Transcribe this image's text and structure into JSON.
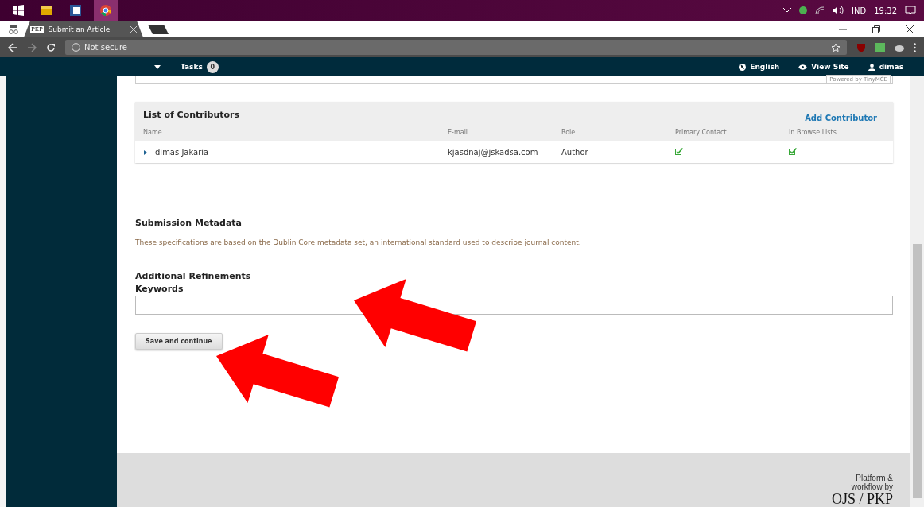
{
  "taskbar": {
    "tray_language": "IND",
    "time": "19:32"
  },
  "browser": {
    "tab_title": "Submit an Article",
    "favicon": "PKP",
    "security": "Not secure"
  },
  "header": {
    "tasks_label": "Tasks",
    "tasks_count": "0",
    "language": "English",
    "view_site": "View Site",
    "user": "dimas"
  },
  "editor": {
    "powered_by": "Powered by TinyMCE"
  },
  "contributors": {
    "title": "List of Contributors",
    "add_label": "Add Contributor",
    "columns": [
      "Name",
      "E-mail",
      "Role",
      "Primary Contact",
      "In Browse Lists"
    ],
    "rows": [
      {
        "name": "dimas Jakaria",
        "email": "kjasdnaj@jskadsa.com",
        "role": "Author",
        "expanded": false,
        "primary_contact": true,
        "in_browse_lists": true
      }
    ]
  },
  "metadata": {
    "title": "Submission Metadata",
    "description": "These specifications are based on the Dublin Core metadata set, an international standard used to describe journal content."
  },
  "refinements": {
    "title": "Additional Refinements",
    "keywords_label": "Keywords"
  },
  "save_button": "Save and continue",
  "footer": {
    "line_1": "Platform &",
    "line_2": "workflow by",
    "logo": "OJS / PKP"
  },
  "overlay_arrows": [
    {
      "kind": "arrow"
    },
    {
      "kind": "arrow"
    }
  ]
}
